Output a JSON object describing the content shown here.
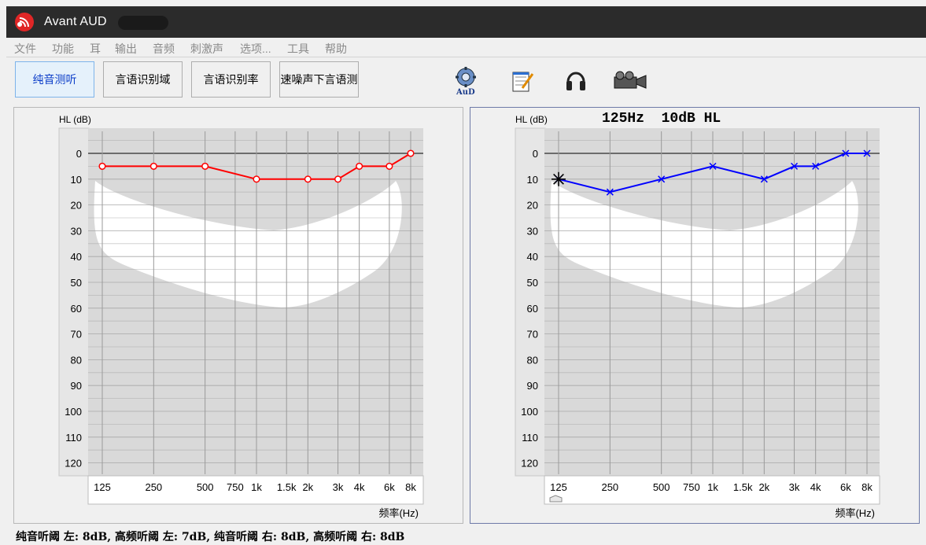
{
  "window": {
    "title": "Avant AUD"
  },
  "menu": [
    "文件",
    "功能",
    "耳",
    "输出",
    "音频",
    "刺激声",
    "选项...",
    "工具",
    "帮助"
  ],
  "toolbar": {
    "buttons": [
      "纯音测听",
      "言语识别域",
      "言语识别率",
      "速噪声下言语测"
    ],
    "icons": [
      "aud-settings-icon",
      "notepad-icon",
      "headphones-icon",
      "video-camera-icon"
    ]
  },
  "audiogram": {
    "y_label": "HL (dB)",
    "x_label": "频率(Hz)",
    "y_ticks": [
      0,
      10,
      20,
      30,
      40,
      50,
      60,
      70,
      80,
      90,
      100,
      110,
      120
    ],
    "x_ticks": [
      "125",
      "250",
      "500",
      "750",
      "1k",
      "1.5k",
      "2k",
      "3k",
      "4k",
      "6k",
      "8k"
    ],
    "right_readout": {
      "freq": "125Hz",
      "level": "10dB HL"
    }
  },
  "chart_data": [
    {
      "type": "line",
      "title": "",
      "ylabel": "HL (dB)",
      "xlabel": "频率(Hz)",
      "ylim": [
        120,
        0
      ],
      "series": [
        {
          "color": "#ff0000",
          "marker": "circle",
          "x": [
            125,
            250,
            500,
            1000,
            2000,
            3000,
            4000,
            6000,
            8000
          ],
          "y": [
            5,
            5,
            5,
            10,
            10,
            10,
            5,
            5,
            0
          ]
        }
      ]
    },
    {
      "type": "line",
      "title": "",
      "ylabel": "HL (dB)",
      "xlabel": "频率(Hz)",
      "ylim": [
        120,
        0
      ],
      "series": [
        {
          "color": "#0000ff",
          "marker": "x",
          "x": [
            125,
            250,
            500,
            1000,
            2000,
            3000,
            4000,
            6000,
            8000
          ],
          "y": [
            10,
            15,
            10,
            5,
            10,
            5,
            5,
            0,
            0
          ]
        }
      ]
    }
  ],
  "status": "纯音听阈 左: 8dB, 高频听阈 左: 7dB, 纯音听阈 右: 8dB, 高频听阈 右: 8dB"
}
